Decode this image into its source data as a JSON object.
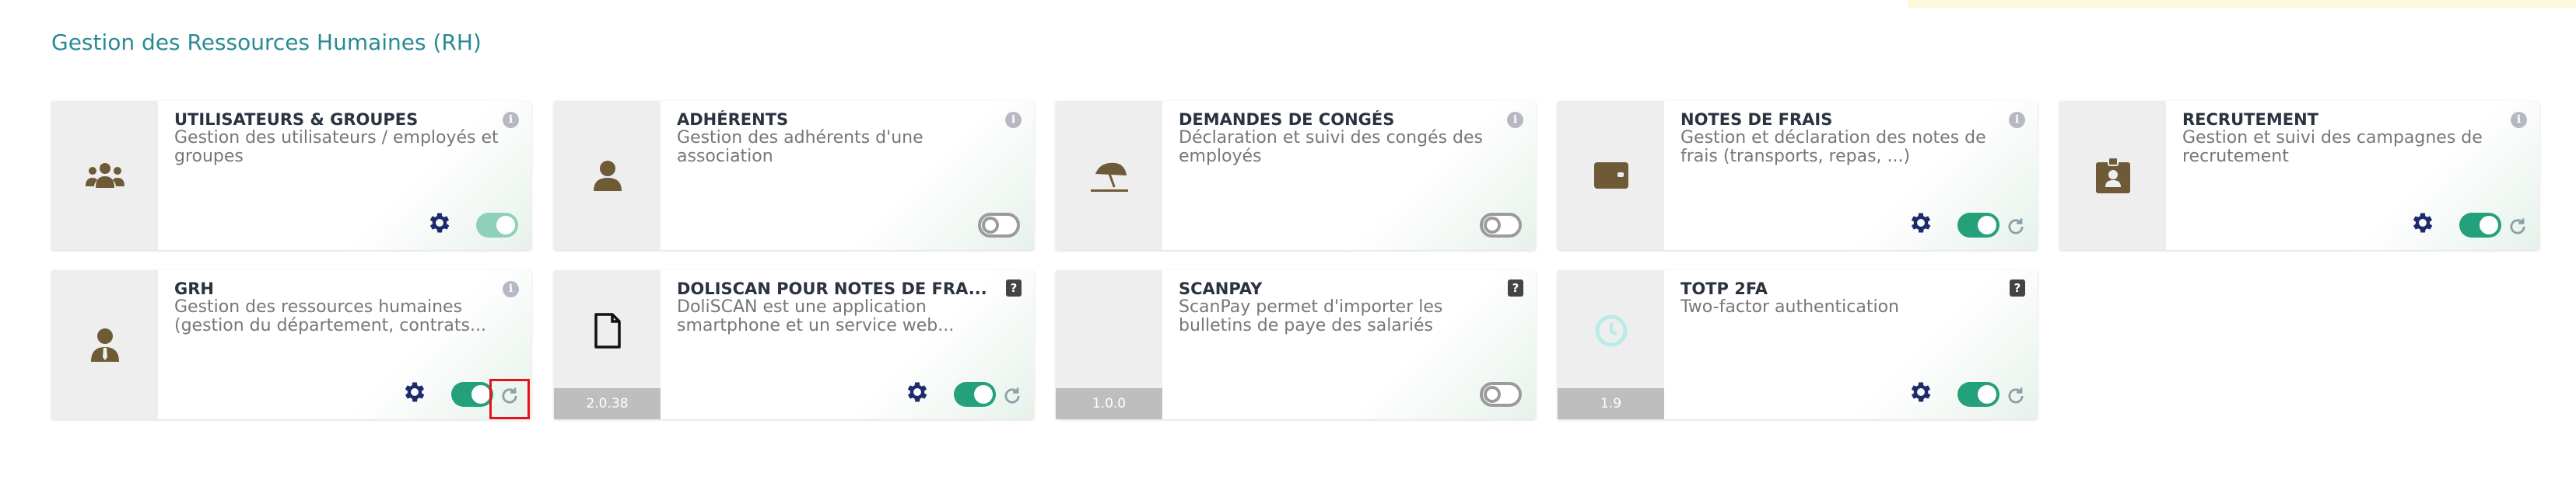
{
  "section": {
    "title": "Gestion des Ressources Humaines (RH)"
  },
  "colors": {
    "accent": "#2a8a94",
    "toggle_on": "#24a07a",
    "gear": "#1e2a6e",
    "icon": "#6e5a36",
    "highlight": "#e8121c"
  },
  "cards": [
    {
      "title": "UTILISATEURS & GROUPES",
      "desc": "Gestion des utilisateurs / employés et groupes",
      "icon": "users-icon",
      "badge": "info",
      "toggle": "on-light",
      "gear": true,
      "refresh": false
    },
    {
      "title": "ADHÉRENTS",
      "desc": "Gestion des adhérents d'une association",
      "icon": "user-icon",
      "badge": "info",
      "toggle": "off",
      "gear": false,
      "refresh": false
    },
    {
      "title": "DEMANDES DE CONGÉS",
      "desc": "Déclaration et suivi des congés des employés",
      "icon": "beach-umbrella-icon",
      "badge": "info",
      "toggle": "off",
      "gear": false,
      "refresh": false
    },
    {
      "title": "NOTES DE FRAIS",
      "desc": "Gestion et déclaration des notes de frais (transports, repas, ...)",
      "icon": "wallet-icon",
      "badge": "info",
      "toggle": "on",
      "gear": true,
      "refresh": true
    },
    {
      "title": "RECRUTEMENT",
      "desc": "Gestion et suivi des campagnes de recrutement",
      "icon": "id-badge-icon",
      "badge": "info",
      "toggle": "on",
      "gear": true,
      "refresh": true
    },
    {
      "title": "GRH",
      "desc": "Gestion des ressources humaines (gestion du département, contrats...",
      "icon": "user-tie-icon",
      "badge": "info",
      "toggle": "on",
      "gear": true,
      "refresh": true
    },
    {
      "title": "DOLISCAN POUR NOTES DE FRA...",
      "desc": "DoliSCAN est une application smartphone et un service web...",
      "icon": "file-icon",
      "badge": "help",
      "version": "2.0.38",
      "toggle": "on",
      "gear": true,
      "refresh": true
    },
    {
      "title": "SCANPAY",
      "desc": "ScanPay permet d'importer les bulletins de paye des salariés",
      "icon": "none",
      "badge": "help",
      "version": "1.0.0",
      "toggle": "off",
      "gear": false,
      "refresh": false
    },
    {
      "title": "TOTP 2FA",
      "desc": "Two-factor authentication",
      "icon": "clock-icon",
      "badge": "help",
      "version": "1.9",
      "toggle": "on",
      "gear": true,
      "refresh": true
    }
  ]
}
